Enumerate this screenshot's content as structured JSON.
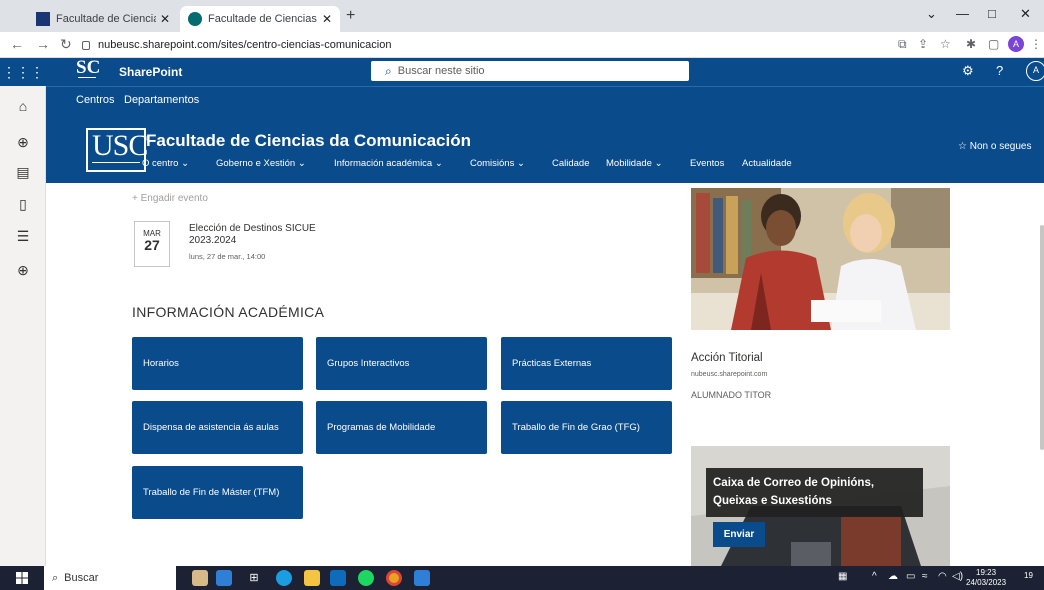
{
  "browser": {
    "tabs": [
      {
        "title": "Facultade de Ciencias da Comuni",
        "active": false
      },
      {
        "title": "Facultade de Ciencias da Comuni",
        "active": true
      }
    ],
    "url": "nubeusc.sharepoint.com/sites/centro-ciencias-comunicacion",
    "profile_initial": "A",
    "icons": [
      "back-icon",
      "forward-icon",
      "reload-icon",
      "new-tab-icon",
      "minimize-icon",
      "maximize-icon",
      "close-icon",
      "extensions-icon",
      "share-icon",
      "star-icon",
      "sidepanel-icon"
    ]
  },
  "suite": {
    "logo": "SC",
    "app_name": "SharePoint",
    "search_placeholder": "Buscar neste sitio",
    "avatar_initial": "A"
  },
  "hub_nav": {
    "items": [
      "Centros",
      "Departamentos"
    ]
  },
  "site": {
    "logo": "USC",
    "title": "Facultade de Ciencias da Comunicación",
    "nav": [
      "O centro",
      "Goberno e Xestión",
      "Información académica",
      "Comisións",
      "Calidade",
      "Mobilidade",
      "Eventos",
      "Actualidade"
    ],
    "follow": "Non o segues"
  },
  "events": {
    "add_label": "Engadir evento",
    "items": [
      {
        "month": "MAR",
        "day": "27",
        "title": "Elección de Destinos SICUE 2023.2024",
        "when": "luns, 27 de mar., 14:00"
      }
    ]
  },
  "academic": {
    "title": "INFORMACIÓN ACADÉMICA",
    "links": [
      "Horarios",
      "Grupos Interactivos",
      "Prácticas Externas",
      "Dispensa de asistencia ás aulas",
      "Programas de Mobilidade",
      "Traballo de Fin de Grao (TFG)",
      "Traballo de Fin de Máster (TFM)"
    ]
  },
  "card": {
    "title": "Acción Titorial",
    "url": "nubeusc.sharepoint.com",
    "subtitle": "ALUMNADO TITOR"
  },
  "hero": {
    "text": "Caixa de Correo de Opinións, Queixas e Suxestións",
    "button": "Enviar"
  },
  "taskbar": {
    "search": "Buscar",
    "time": "19:23",
    "date": "24/03/2023",
    "notification_count": "19"
  },
  "colors": {
    "brand": "#0a4b8c",
    "browser_chrome": "#dee1e6",
    "taskbar": "#1c2233"
  }
}
